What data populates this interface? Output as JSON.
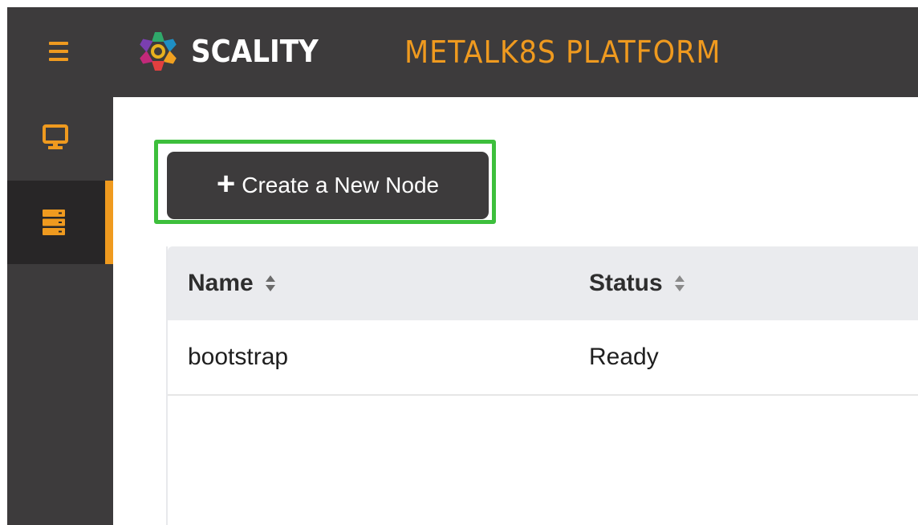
{
  "header": {
    "brand": "SCALITY",
    "product": "METALK8S PLATFORM",
    "accent_color": "#ef9a1f",
    "menu_icon": "hamburger-icon"
  },
  "sidebar": {
    "items": [
      {
        "icon": "monitor-icon",
        "active": false
      },
      {
        "icon": "server-icon",
        "active": true
      }
    ]
  },
  "main": {
    "create_button": {
      "icon": "plus-icon",
      "label": "Create a New Node"
    },
    "table": {
      "columns": [
        {
          "label": "Name",
          "sort_icon": "sort-icon"
        },
        {
          "label": "Status",
          "sort_icon": "sort-icon"
        }
      ],
      "rows": [
        {
          "name": "bootstrap",
          "status": "Ready"
        }
      ]
    }
  }
}
